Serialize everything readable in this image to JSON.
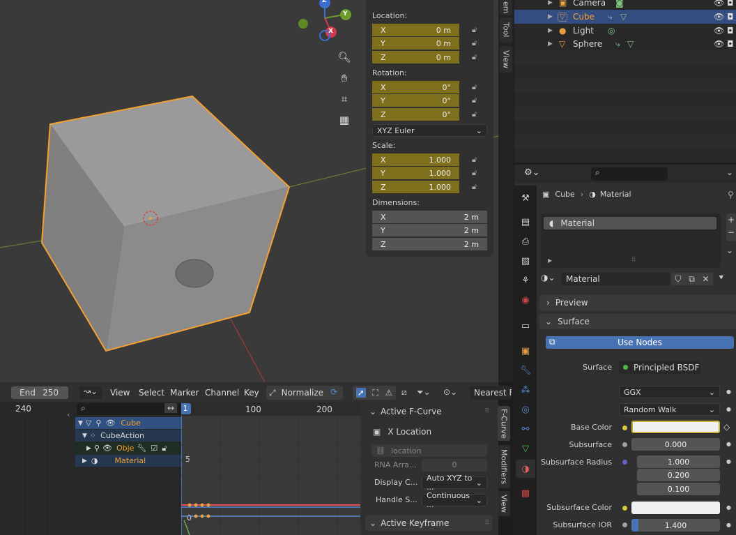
{
  "viewport": {
    "gizmo": {
      "z": "Z",
      "y": "Y",
      "x": "X"
    },
    "nav_icons": [
      "zoom-icon",
      "hand-icon",
      "camera-icon",
      "grid-icon"
    ]
  },
  "npanel": {
    "location_label": "Location:",
    "location": [
      {
        "axis": "X",
        "value": "0 m"
      },
      {
        "axis": "Y",
        "value": "0 m"
      },
      {
        "axis": "Z",
        "value": "0 m"
      }
    ],
    "rotation_label": "Rotation:",
    "rotation": [
      {
        "axis": "X",
        "value": "0°"
      },
      {
        "axis": "Y",
        "value": "0°"
      },
      {
        "axis": "Z",
        "value": "0°"
      }
    ],
    "rotation_mode": "XYZ Euler",
    "scale_label": "Scale:",
    "scale": [
      {
        "axis": "X",
        "value": "1.000"
      },
      {
        "axis": "Y",
        "value": "1.000"
      },
      {
        "axis": "Z",
        "value": "1.000"
      }
    ],
    "dimensions_label": "Dimensions:",
    "dimensions": [
      {
        "axis": "X",
        "value": "2 m"
      },
      {
        "axis": "Y",
        "value": "2 m"
      },
      {
        "axis": "Z",
        "value": "2 m"
      }
    ],
    "tabs": [
      "em",
      "Tool",
      "View"
    ]
  },
  "outliner": {
    "rows": [
      {
        "name": "Camera",
        "selected": false
      },
      {
        "name": "Cube",
        "selected": true
      },
      {
        "name": "Light",
        "selected": false
      },
      {
        "name": "Sphere",
        "selected": false
      }
    ]
  },
  "properties": {
    "breadcrumb": {
      "object": "Cube",
      "material": "Material"
    },
    "slot_name": "Material",
    "material_name": "Material",
    "preview_label": "Preview",
    "surface_panel_label": "Surface",
    "use_nodes_label": "Use Nodes",
    "surface_label": "Surface",
    "surface_value": "Principled BSDF",
    "distribution": "GGX",
    "subsurface_method": "Random Walk",
    "base_color_label": "Base Color",
    "subsurface_label": "Subsurface",
    "subsurface_value": "0.000",
    "subsurface_radius_label": "Subsurface Radius",
    "subsurface_radius": [
      "1.000",
      "0.200",
      "0.100"
    ],
    "subsurface_color_label": "Subsurface Color",
    "subsurface_ior_label": "Subsurface IOR",
    "subsurface_ior_value": "1.400",
    "subsurface_ior_fraction": 0.08
  },
  "timeline": {
    "end_label": "End",
    "end_value": "250",
    "ruler_left": "240",
    "current_frame": "1",
    "ruler_ticks": [
      "100",
      "200"
    ],
    "y_ticks": [
      "5",
      "0"
    ]
  },
  "graph_editor": {
    "menus": [
      "View",
      "Select",
      "Marker",
      "Channel",
      "Key"
    ],
    "normalize_label": "Normalize",
    "snap_label": "Nearest Fra",
    "channels": [
      {
        "name": "Cube"
      },
      {
        "name": "CubeAction"
      },
      {
        "name": "Obje"
      },
      {
        "name": "Material"
      }
    ]
  },
  "fcurve_sidebar": {
    "active_fcurve_label": "Active F-Curve",
    "fcurve_name": "X Location",
    "data_path": "location",
    "rna_array_label": "RNA Arra...",
    "rna_array_value": "0",
    "display_color_label": "Display C...",
    "display_color_value": "Auto XYZ to ...",
    "handle_smoothing_label": "Handle S...",
    "handle_smoothing_value": "Continuous ...",
    "active_keyframe_label": "Active Keyframe",
    "tabs": [
      "F-Curve",
      "Modifiers",
      "View"
    ]
  },
  "colors": {
    "selected_orange": "#f5a030",
    "field_gold": "#7e6f1d",
    "accent_blue": "#4772b3"
  }
}
